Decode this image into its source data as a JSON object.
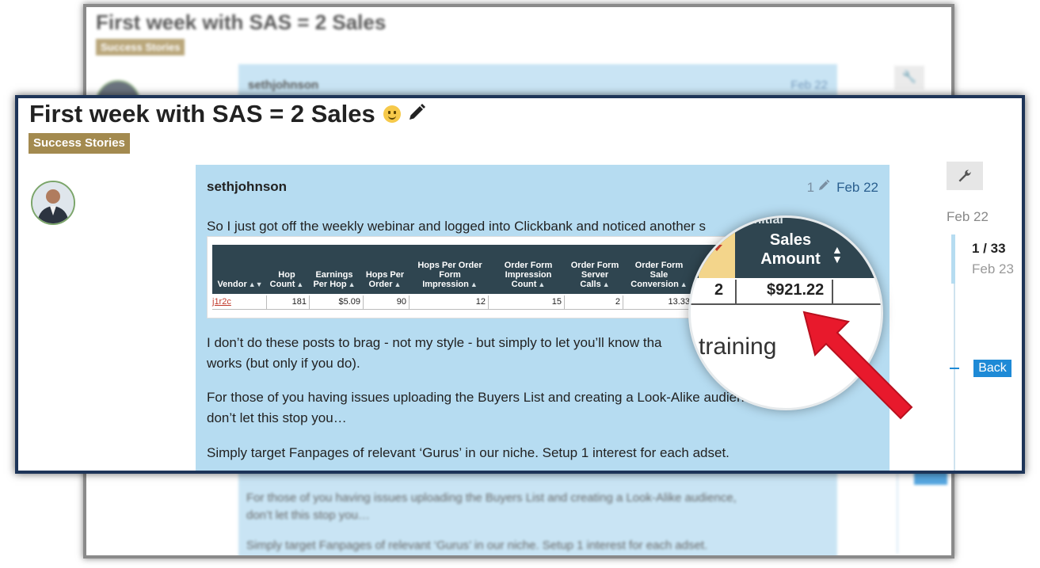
{
  "topic": {
    "title": "First week with SAS = 2 Sales",
    "category": "Success Stories"
  },
  "post": {
    "username": "sethjohnson",
    "edit_count": "1",
    "date": "Feb 22",
    "paragraphs": [
      "So I just got off the weekly webinar and logged into Clickbank and noticed another s",
      "I don’t do these posts to brag - not my style - but simply to let you’ll know tha",
      "works (but only if you do).",
      "For those of you having issues uploading the Buyers List and creating a Look-Alike audience,",
      "don’t let this stop you…",
      "Simply target Fanpages of relevant ‘Gurus’ in our niche. Setup 1 interest for each adset."
    ],
    "bg_paragraphs": [
      "For those of you having issues uploading the Buyers List and creating a Look-Alike audience,",
      "don’t let this stop you…",
      "Simply target Fanpages of relevant ‘Gurus’ in our niche. Setup 1 interest for each adset."
    ]
  },
  "clickbank_table": {
    "headers": [
      "Vendor",
      "Hop Count",
      "Earnings Per Hop",
      "Hops Per Order",
      "Hops Per Order Form Impression",
      "Order Form Impression Count",
      "Order Form Server Calls",
      "Order Form Sale Conversion"
    ],
    "row": {
      "vendor": "j1r2c",
      "hop_count": "181",
      "earnings_per_hop": "$5.09",
      "hops_per_order": "90",
      "hops_per_impression": "12",
      "impression_count": "15",
      "server_calls": "2",
      "sale_conversion": "13.33"
    }
  },
  "magnifier": {
    "header_top": "Initial",
    "header_label": "Sales Amount",
    "quantity": "2",
    "amount": "$921.22",
    "caption": "training"
  },
  "timeline": {
    "start_date": "Feb 22",
    "position": "1 / 33",
    "current_date": "Feb 23",
    "back_label": "Back"
  },
  "colors": {
    "frame_border": "#1d3458",
    "post_background": "#b6dcf1",
    "category_badge": "#a38a4f",
    "table_header": "#2f4550",
    "accent_blue": "#1e8ad6",
    "arrow_red": "#e8192c"
  }
}
